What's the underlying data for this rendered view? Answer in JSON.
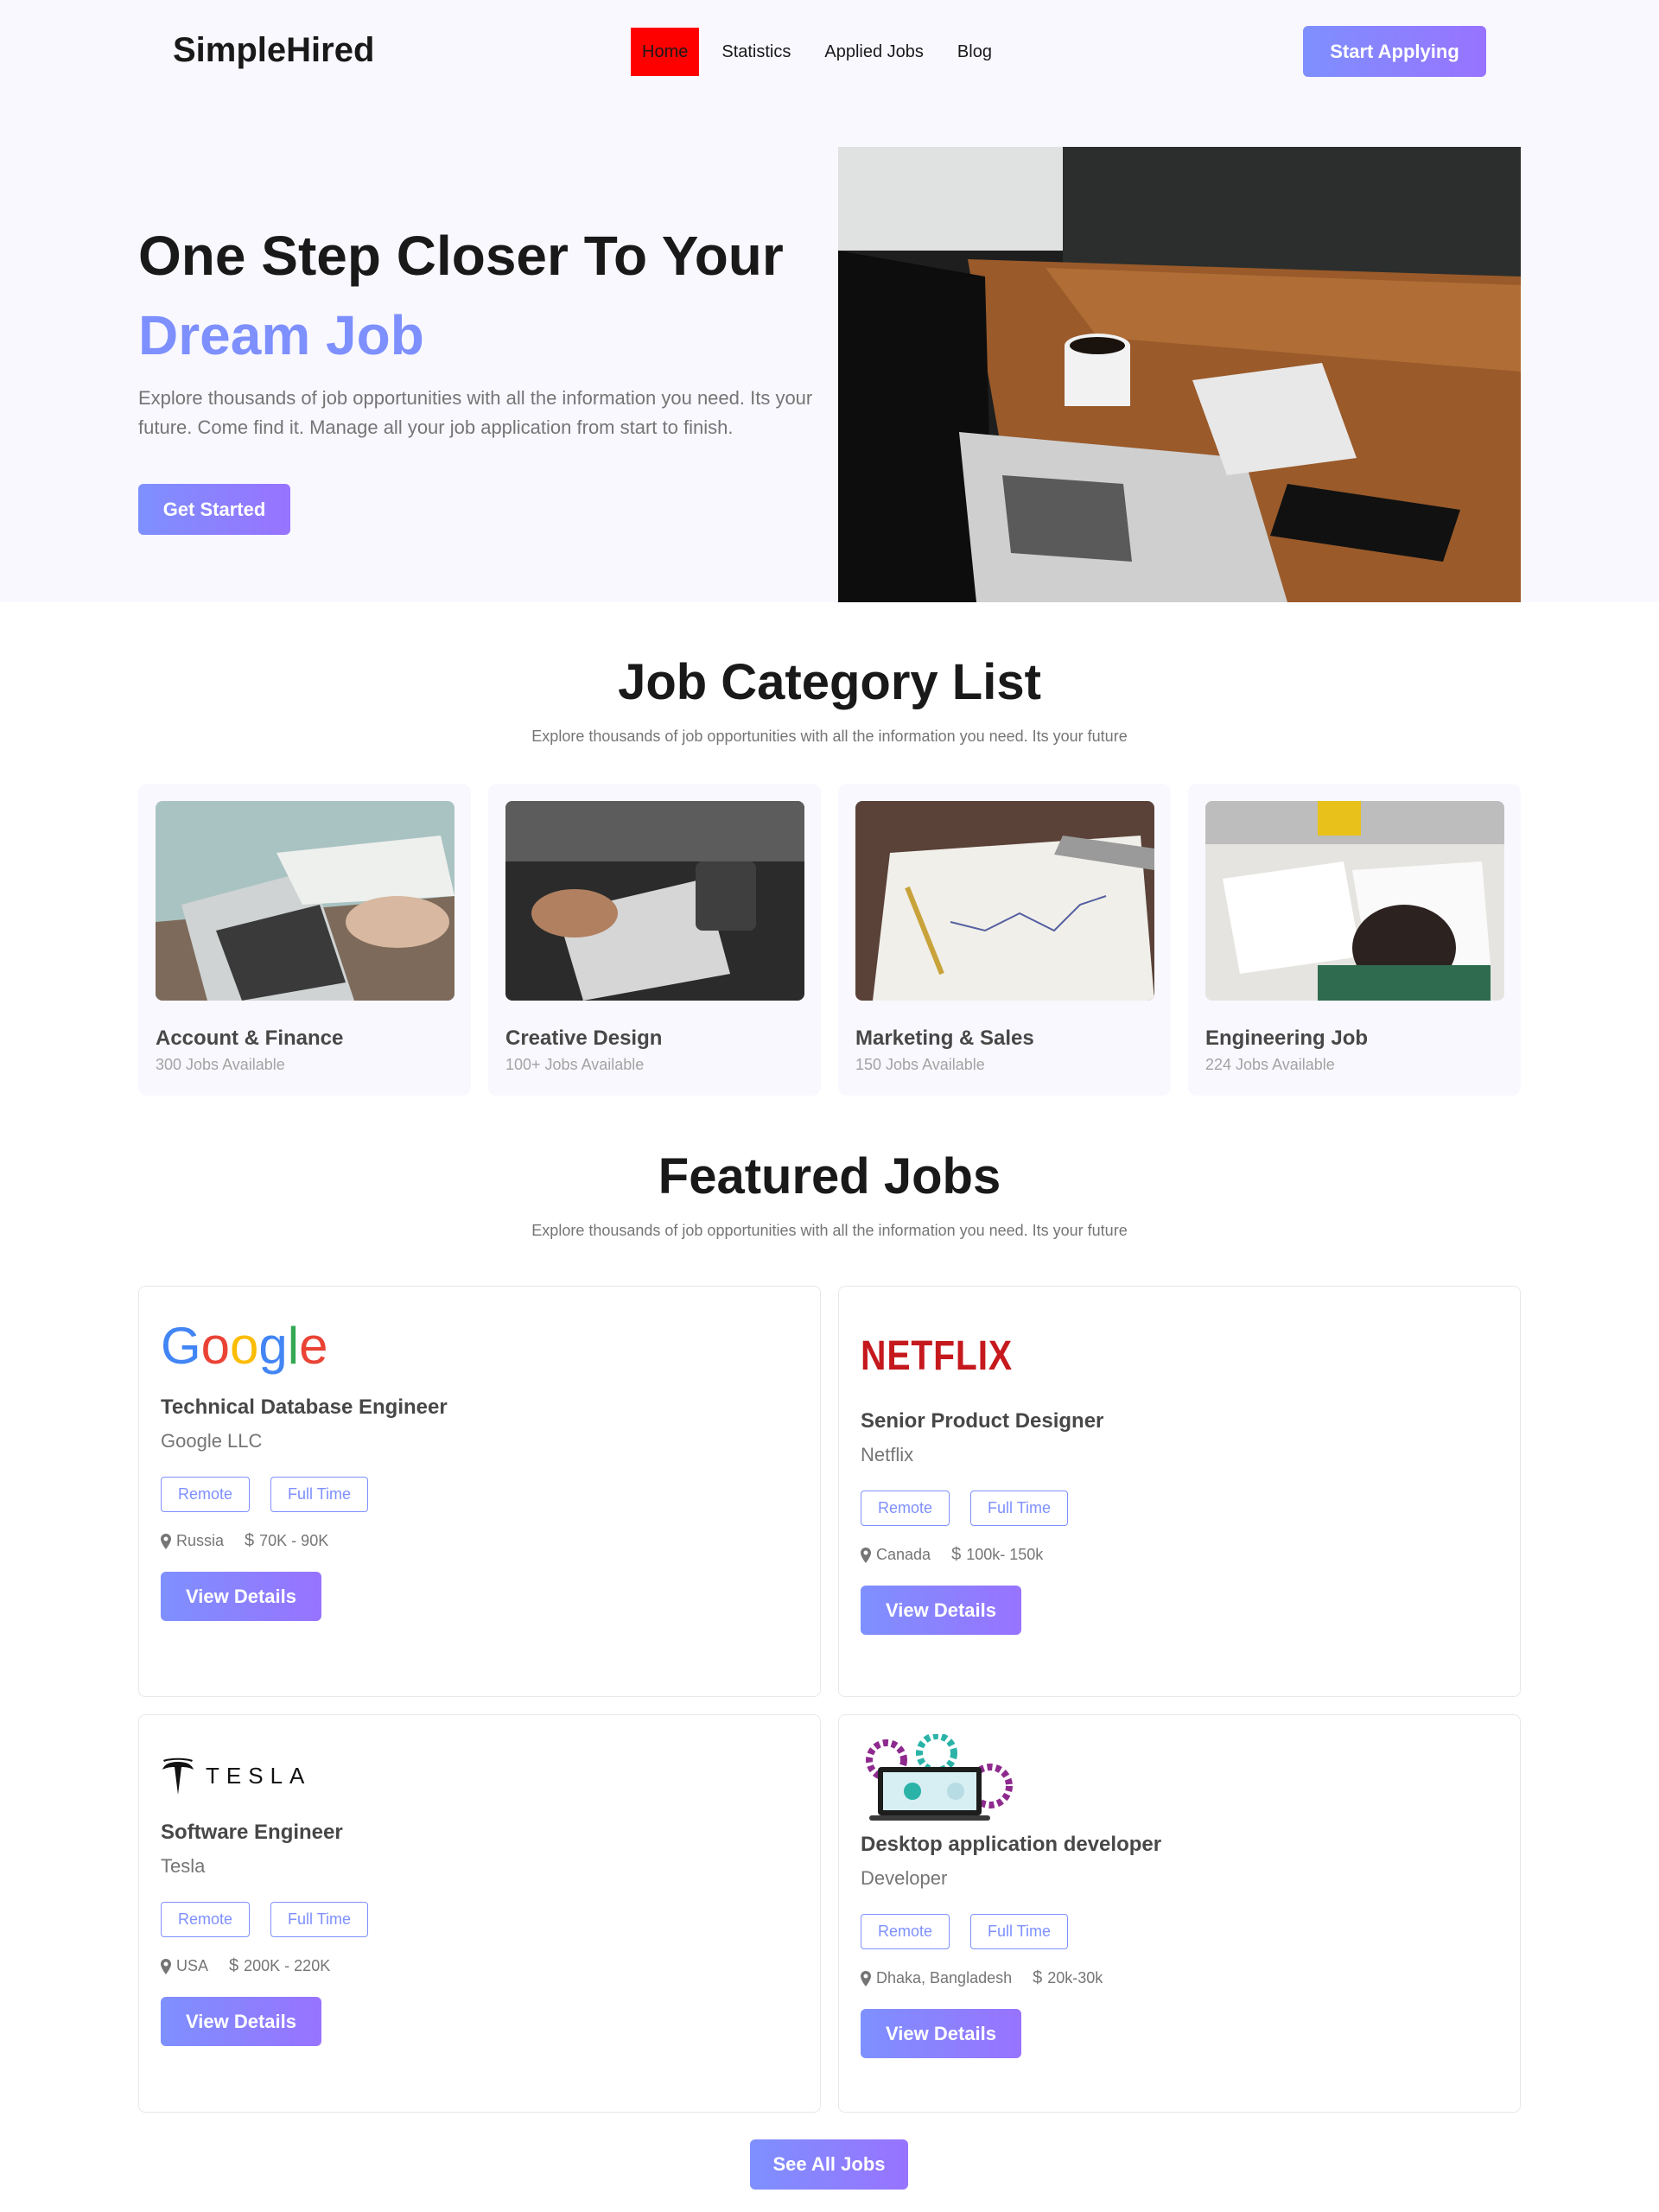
{
  "nav": {
    "logo": "SimpleHired",
    "links": [
      "Home",
      "Statistics",
      "Applied Jobs",
      "Blog"
    ],
    "cta": "Start Applying"
  },
  "hero": {
    "title_line1": "One Step Closer To Your",
    "title_accent": "Dream Job",
    "description": "Explore thousands of job opportunities with all the information you need. Its your future. Come find it. Manage all your job application from start to finish.",
    "cta": "Get Started"
  },
  "categories": {
    "title": "Job Category List",
    "subtitle": "Explore thousands of job opportunities with all the information you need. Its your future",
    "items": [
      {
        "name": "Account & Finance",
        "count": "300 Jobs Available"
      },
      {
        "name": "Creative Design",
        "count": "100+ Jobs Available"
      },
      {
        "name": "Marketing & Sales",
        "count": "150 Jobs Available"
      },
      {
        "name": "Engineering Job",
        "count": "224 Jobs Available"
      }
    ]
  },
  "featured": {
    "title": "Featured Jobs",
    "subtitle": "Explore thousands of job opportunities with all the information you need. Its your future",
    "jobs": [
      {
        "logo": "Google",
        "title": "Technical Database Engineer",
        "company": "Google LLC",
        "tags": [
          "Remote",
          "Full Time"
        ],
        "location": "Russia",
        "salary": "70K - 90K",
        "button": "View Details"
      },
      {
        "logo": "NETFLIX",
        "title": "Senior Product Designer",
        "company": "Netflix",
        "tags": [
          "Remote",
          "Full Time"
        ],
        "location": "Canada",
        "salary": "100k- 150k",
        "button": "View Details"
      },
      {
        "logo": "TESLA",
        "title": "Software Engineer",
        "company": "Tesla",
        "tags": [
          "Remote",
          "Full Time"
        ],
        "location": "USA",
        "salary": "200K - 220K",
        "button": "View Details"
      },
      {
        "logo": "",
        "title": "Desktop application developer",
        "company": "Developer",
        "tags": [
          "Remote",
          "Full Time"
        ],
        "location": "Dhaka, Bangladesh",
        "salary": "20k-30k",
        "button": "View Details"
      }
    ],
    "see_all": "See All Jobs"
  },
  "colors": {
    "accent": "#7e90fe",
    "accent2": "#9873ff",
    "hero_bg": "#f9f8ff",
    "active_nav": "#ff0000"
  }
}
